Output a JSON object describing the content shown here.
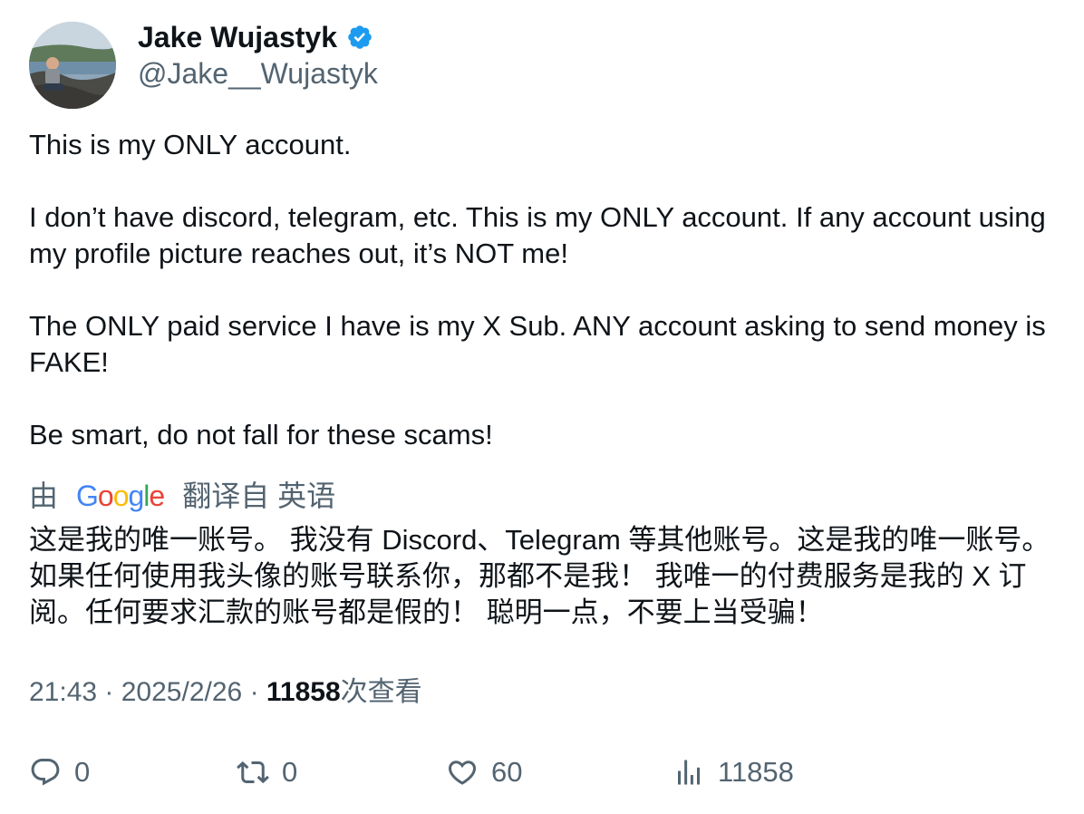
{
  "author": {
    "display_name": "Jake Wujastyk",
    "handle": "@Jake__Wujastyk",
    "verified_icon": "verified-badge-icon",
    "verified_color": "#1d9bf0"
  },
  "tweet": {
    "paragraphs": [
      "This is my ONLY account.",
      "I don’t have discord, telegram, etc. This is my ONLY account. If any account using my profile picture reaches out, it’s NOT me!",
      "The ONLY paid service I have is my X Sub. ANY account asking to send money is FAKE!",
      "Be smart, do not fall for these scams!"
    ]
  },
  "translation": {
    "prefix": "由",
    "brand": "Google",
    "suffix": "翻译自 英语",
    "text": "这是我的唯一账号。 我没有 Discord、Telegram 等其他账号。这是我的唯一账号。如果任何使用我头像的账号联系你，那都不是我！ 我唯一的付费服务是我的 X 订阅。任何要求汇款的账号都是假的！ 聪明一点，不要上当受骗！"
  },
  "meta": {
    "time": "21:43",
    "date": "2025/2/26",
    "views": "11858",
    "views_label": "次查看"
  },
  "actions": {
    "replies": "0",
    "reposts": "0",
    "likes": "60",
    "views": "11858"
  }
}
